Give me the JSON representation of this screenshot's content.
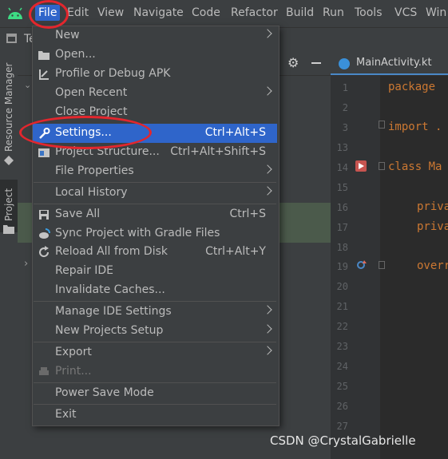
{
  "menubar": {
    "items": [
      "File",
      "Edit",
      "View",
      "Navigate",
      "Code",
      "Refactor",
      "Build",
      "Run",
      "Tools",
      "VCS",
      "Win"
    ]
  },
  "navbar": {
    "title": "Te"
  },
  "leftstrip": {
    "resource_manager": "Resource Manager",
    "project": "Project"
  },
  "editor": {
    "tab_label": "MainActivity.kt",
    "line_numbers": [
      "1",
      "2",
      "3",
      "13",
      "14",
      "15",
      "16",
      "17",
      "18",
      "19",
      "20",
      "21",
      "22",
      "23",
      "24",
      "25",
      "26",
      "27"
    ],
    "code": {
      "package": "package",
      "import": "import .",
      "class": "class Ma",
      "priv1": "priva",
      "priv2": "priva",
      "over": "overr"
    }
  },
  "menu": {
    "items": [
      {
        "label": "New",
        "submenu": true,
        "icon": ""
      },
      {
        "label": "Open...",
        "icon": "folder-icon"
      },
      {
        "label": "Profile or Debug APK",
        "icon": "profile-icon"
      },
      {
        "label": "Open Recent",
        "submenu": true
      },
      {
        "label": "Close Project"
      },
      {
        "label": "Settings...",
        "shortcut": "Ctrl+Alt+S",
        "icon": "wrench-icon",
        "selected": true
      },
      {
        "label": "Project Structure...",
        "shortcut": "Ctrl+Alt+Shift+S",
        "icon": "project-structure-icon"
      },
      {
        "label": "File Properties",
        "submenu": true
      },
      {
        "label": "Local History",
        "submenu": true
      },
      {
        "label": "Save All",
        "shortcut": "Ctrl+S",
        "icon": "save-icon"
      },
      {
        "label": "Sync Project with Gradle Files",
        "icon": "gradle-sync-icon"
      },
      {
        "label": "Reload All from Disk",
        "shortcut": "Ctrl+Alt+Y",
        "icon": "reload-icon"
      },
      {
        "label": "Repair IDE"
      },
      {
        "label": "Invalidate Caches..."
      },
      {
        "label": "Manage IDE Settings",
        "submenu": true
      },
      {
        "label": "New Projects Setup",
        "submenu": true
      },
      {
        "label": "Export",
        "submenu": true
      },
      {
        "label": "Print...",
        "icon": "print-icon",
        "disabled": true
      },
      {
        "label": "Power Save Mode"
      },
      {
        "label": "Exit"
      }
    ]
  },
  "watermark": "CSDN @CrystalGabrielle",
  "colors": {
    "selection": "#2f65ca",
    "annotation": "#e3262d",
    "menu_bg": "#3c3f41"
  }
}
